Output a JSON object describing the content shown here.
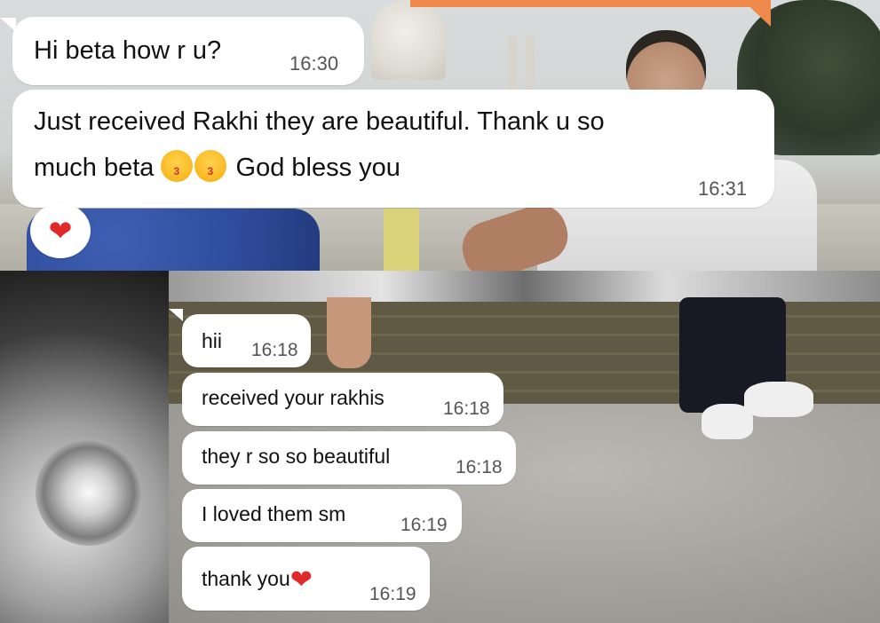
{
  "chat_top": {
    "messages": [
      {
        "text": "Hi beta how r u?",
        "time": "16:30"
      },
      {
        "line1": "Just received Rakhi they are beautiful. Thank u so",
        "line2_a": "much beta",
        "line2_b": "God bless you",
        "time": "16:31",
        "emoji": "kissing-face-with-heart-icon"
      }
    ],
    "reaction": "❤"
  },
  "chat_bottom": {
    "messages": [
      {
        "text": "hii",
        "time": "16:18"
      },
      {
        "text": "received your rakhis",
        "time": "16:18"
      },
      {
        "text": "they r so so beautiful",
        "time": "16:18"
      },
      {
        "text": "I loved them sm",
        "time": "16:19"
      },
      {
        "text": "thank you",
        "time": "16:19",
        "emoji": "❤"
      }
    ]
  },
  "colors": {
    "bubble": "#ffffff",
    "accent_orange": "#f08a4c",
    "heart": "#e02a2a"
  }
}
